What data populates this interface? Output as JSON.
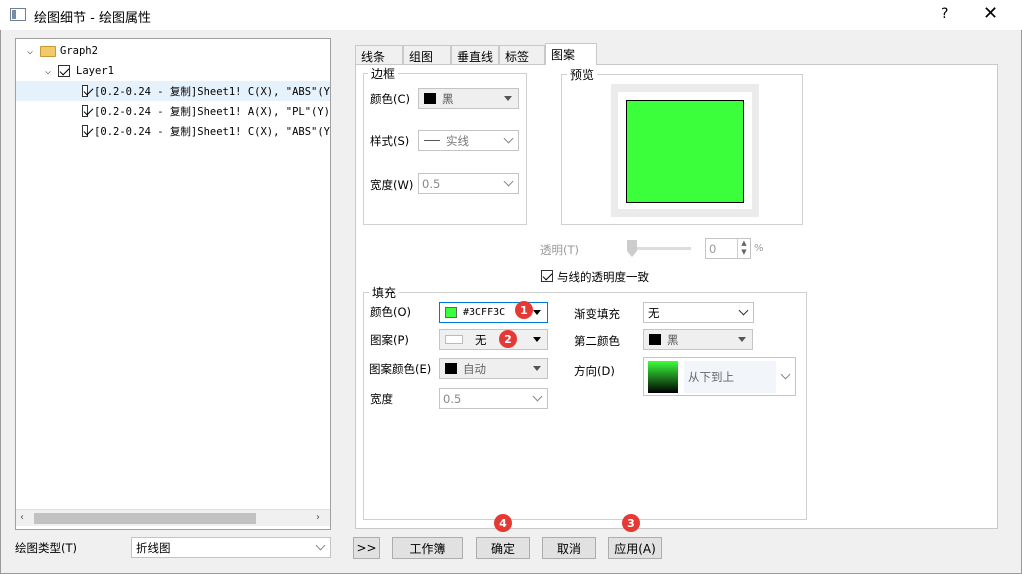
{
  "window": {
    "title": "绘图细节 - 绘图属性",
    "help": "?",
    "close": "✕"
  },
  "tree": {
    "root": "Graph2",
    "layer": "Layer1",
    "items": [
      "[0.2-0.24 - 复制]Sheet1! C(X), \"ABS\"(Y",
      "[0.2-0.24 - 复制]Sheet1! A(X), \"PL\"(Y)",
      "[0.2-0.24 - 复制]Sheet1! C(X), \"ABS\"(Y"
    ]
  },
  "plot_type": {
    "label": "绘图类型(T)",
    "value": "折线图"
  },
  "tabs": [
    "线条",
    "组图",
    "垂直线",
    "标签",
    "图案"
  ],
  "border_group": {
    "title": "边框",
    "color_label": "颜色(C)",
    "color_value": "黑",
    "style_label": "样式(S)",
    "style_value": "实线",
    "width_label": "宽度(W)",
    "width_value": "0.5"
  },
  "preview": {
    "title": "预览",
    "fill_color": "#3CFF3C"
  },
  "transparency": {
    "label": "透明(T)",
    "value": "0",
    "unit": "%"
  },
  "match_line": {
    "label": "与线的透明度一致",
    "checked": true
  },
  "fill_group": {
    "title": "填充",
    "color_label": "颜色(O)",
    "color_value": "#3CFF3C",
    "pattern_label": "图案(P)",
    "pattern_value": "无",
    "pattern_color_label": "图案颜色(E)",
    "pattern_color_value": "自动",
    "width_label": "宽度",
    "width_value": "0.5",
    "gradient_label": "渐变填充",
    "gradient_value": "无",
    "second_color_label": "第二颜色",
    "second_color_value": "黑",
    "direction_label": "方向(D)",
    "direction_value": "从下到上"
  },
  "badges": [
    "1",
    "2",
    "3",
    "4"
  ],
  "buttons": {
    "expand": ">>",
    "workbook": "工作簿",
    "ok": "确定",
    "cancel": "取消",
    "apply": "应用(A)"
  },
  "colors": {
    "accent_fill": "#3CFF3C",
    "badge": "#E53935"
  }
}
